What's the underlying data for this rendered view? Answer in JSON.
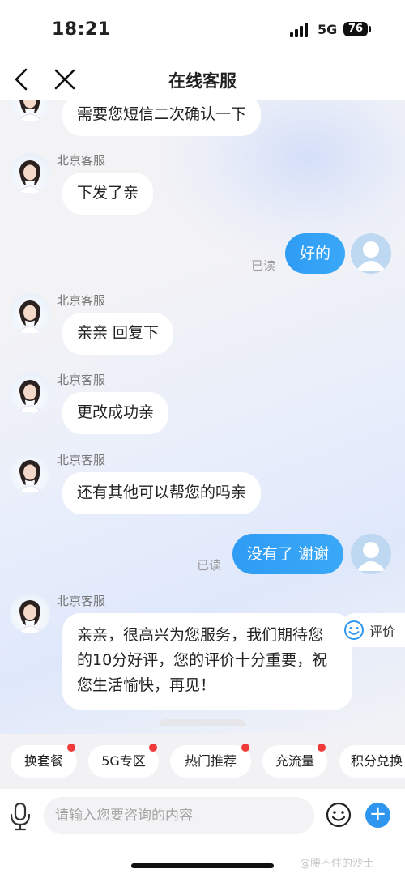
{
  "status_bar": {
    "time": "18:21",
    "network": "5G",
    "battery": "76"
  },
  "nav": {
    "title": "在线客服"
  },
  "agent_name": "北京客服",
  "read_label": "已读",
  "messages": [
    {
      "from": "agent",
      "text": "需要您短信二次确认一下"
    },
    {
      "from": "agent",
      "name": "北京客服",
      "text": "下发了亲"
    },
    {
      "from": "user",
      "text": "好的",
      "status": "已读"
    },
    {
      "from": "agent",
      "name": "北京客服",
      "text": "亲亲 回复下"
    },
    {
      "from": "agent",
      "name": "北京客服",
      "text": "更改成功亲"
    },
    {
      "from": "agent",
      "name": "北京客服",
      "text": "还有其他可以帮您的吗亲"
    },
    {
      "from": "user",
      "text": "没有了 谢谢",
      "status": "已读"
    },
    {
      "from": "agent",
      "name": "北京客服",
      "text": "亲亲，很高兴为您服务，我们期待您的10分好评，您的评价十分重要，祝您生活愉快，再见！"
    }
  ],
  "rate_button": {
    "label": "评价",
    "icon": "smiley-icon"
  },
  "quick_replies": [
    {
      "label": "换套餐",
      "badge": true
    },
    {
      "label": "5G专区",
      "badge": true
    },
    {
      "label": "热门推荐",
      "badge": true
    },
    {
      "label": "充流量",
      "badge": true
    },
    {
      "label": "积分兑换",
      "badge": false
    }
  ],
  "input": {
    "placeholder": "请输入您要咨询的内容"
  },
  "watermark": "@腰不住的沙士",
  "colors": {
    "accent": "#2f96f0",
    "badge": "#f03a3a",
    "bubble_out": "#3aa8f7"
  }
}
